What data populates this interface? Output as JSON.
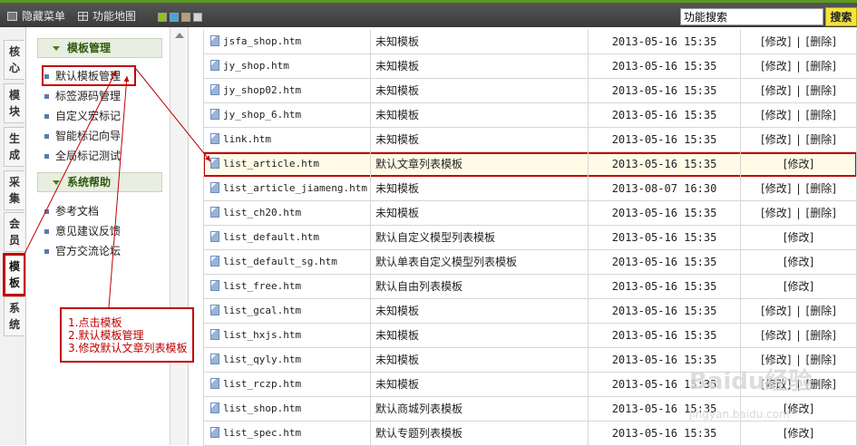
{
  "topbar": {
    "hide_menu": "隐藏菜单",
    "site_map": "功能地图",
    "swatch_colors": [
      "#8fc21b",
      "#43a6d9",
      "#b89e76",
      "#d4d4d4"
    ],
    "search_value": "功能搜索",
    "search_button": "搜索"
  },
  "left_tabs": [
    {
      "label": "核心"
    },
    {
      "label": "模块"
    },
    {
      "label": "生成"
    },
    {
      "label": "采集"
    },
    {
      "label": "会员"
    },
    {
      "label": "模板"
    },
    {
      "label": "系统"
    }
  ],
  "menu": {
    "group1": "模板管理",
    "group1_items": [
      "默认模板管理",
      "标签源码管理",
      "自定义宏标记",
      "智能标记向导",
      "全局标记测试"
    ],
    "group2": "系统帮助",
    "group2_items": [
      "参考文档",
      "意见建议反馈",
      "官方交流论坛"
    ]
  },
  "actions": {
    "edit": "[修改]",
    "sep": "|",
    "delete": "[删除]"
  },
  "table_rows": [
    {
      "file": "jsfa_shop.htm",
      "desc": "未知模板",
      "date": "2013-05-16 15:35",
      "deletable": true
    },
    {
      "file": "jy_shop.htm",
      "desc": "未知模板",
      "date": "2013-05-16 15:35",
      "deletable": true
    },
    {
      "file": "jy_shop02.htm",
      "desc": "未知模板",
      "date": "2013-05-16 15:35",
      "deletable": true
    },
    {
      "file": "jy_shop_6.htm",
      "desc": "未知模板",
      "date": "2013-05-16 15:35",
      "deletable": true
    },
    {
      "file": "link.htm",
      "desc": "未知模板",
      "date": "2013-05-16 15:35",
      "deletable": true
    },
    {
      "file": "list_article.htm",
      "desc": "默认文章列表模板",
      "date": "2013-05-16 15:35",
      "deletable": false
    },
    {
      "file": "list_article_jiameng.htm",
      "desc": "未知模板",
      "date": "2013-08-07 16:30",
      "deletable": true
    },
    {
      "file": "list_ch20.htm",
      "desc": "未知模板",
      "date": "2013-05-16 15:35",
      "deletable": true
    },
    {
      "file": "list_default.htm",
      "desc": "默认自定义模型列表模板",
      "date": "2013-05-16 15:35",
      "deletable": false
    },
    {
      "file": "list_default_sg.htm",
      "desc": "默认单表自定义模型列表模板",
      "date": "2013-05-16 15:35",
      "deletable": false
    },
    {
      "file": "list_free.htm",
      "desc": "默认自由列表模板",
      "date": "2013-05-16 15:35",
      "deletable": false
    },
    {
      "file": "list_gcal.htm",
      "desc": "未知模板",
      "date": "2013-05-16 15:35",
      "deletable": true
    },
    {
      "file": "list_hxjs.htm",
      "desc": "未知模板",
      "date": "2013-05-16 15:35",
      "deletable": true
    },
    {
      "file": "list_qyly.htm",
      "desc": "未知模板",
      "date": "2013-05-16 15:35",
      "deletable": true
    },
    {
      "file": "list_rczp.htm",
      "desc": "未知模板",
      "date": "2013-05-16 15:35",
      "deletable": true
    },
    {
      "file": "list_shop.htm",
      "desc": "默认商城列表模板",
      "date": "2013-05-16 15:35",
      "deletable": false
    },
    {
      "file": "list_spec.htm",
      "desc": "默认专题列表模板",
      "date": "2013-05-16 15:35",
      "deletable": false
    }
  ],
  "annotation": {
    "lines": [
      "1.点击模板",
      "2.默认模板管理",
      "3.修改默认文章列表模板"
    ]
  },
  "watermark": {
    "main": "Baidu经验",
    "sub": "jingyan.baidu.com"
  }
}
